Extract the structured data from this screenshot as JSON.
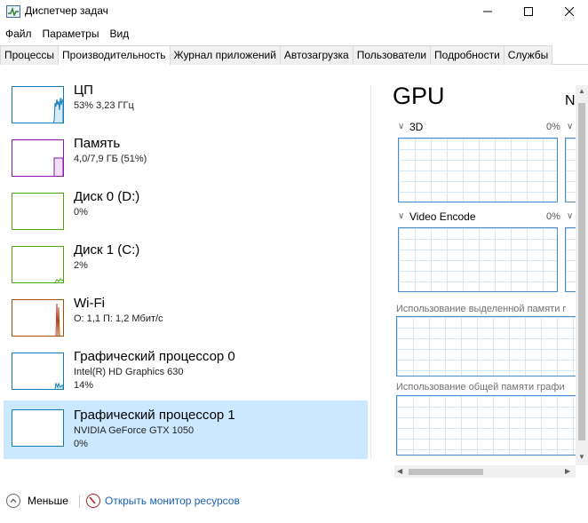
{
  "window": {
    "title": "Диспетчер задач",
    "icon": "task-manager-icon"
  },
  "menu": [
    "Файл",
    "Параметры",
    "Вид"
  ],
  "tabs": [
    {
      "label": "Процессы",
      "active": false
    },
    {
      "label": "Производительность",
      "active": true
    },
    {
      "label": "Журнал приложений",
      "active": false
    },
    {
      "label": "Автозагрузка",
      "active": false
    },
    {
      "label": "Пользователи",
      "active": false
    },
    {
      "label": "Подробности",
      "active": false
    },
    {
      "label": "Службы",
      "active": false
    }
  ],
  "resources": [
    {
      "title": "ЦП",
      "sub1": "53% 3,23 ГГц",
      "sub2": "",
      "color": "#117dbb",
      "selected": false
    },
    {
      "title": "Память",
      "sub1": "4,0/7,9 ГБ (51%)",
      "sub2": "",
      "color": "#8b12ae",
      "selected": false
    },
    {
      "title": "Диск 0 (D:)",
      "sub1": "0%",
      "sub2": "",
      "color": "#4da60c",
      "selected": false
    },
    {
      "title": "Диск 1 (C:)",
      "sub1": "2%",
      "sub2": "",
      "color": "#4da60c",
      "selected": false
    },
    {
      "title": "Wi-Fi",
      "sub1": "О: 1,1 П: 1,2 Мбит/с",
      "sub2": "",
      "color": "#a74f01",
      "selected": false
    },
    {
      "title": "Графический процессор 0",
      "sub1": "Intel(R) HD Graphics 630",
      "sub2": "14%",
      "color": "#117dbb",
      "selected": false
    },
    {
      "title": "Графический процессор 1",
      "sub1": "NVIDIA GeForce GTX 1050",
      "sub2": "0%",
      "color": "#117dbb",
      "selected": true
    }
  ],
  "gpu_panel": {
    "title": "GPU",
    "right_letter": "N",
    "engines": [
      {
        "label": "3D",
        "pct": "0%"
      },
      {
        "label": "Video Encode",
        "pct": "0%"
      }
    ],
    "dedicated_memory_label": "Использование выделенной памяти г",
    "shared_memory_label": "Использование общей памяти графи"
  },
  "footer": {
    "fewer_label": "Меньше",
    "monitor_label": "Открыть монитор ресурсов"
  },
  "colors": {
    "accent": "#117dbb",
    "selected_bg": "#cce8ff",
    "link": "#1a5fb4"
  }
}
